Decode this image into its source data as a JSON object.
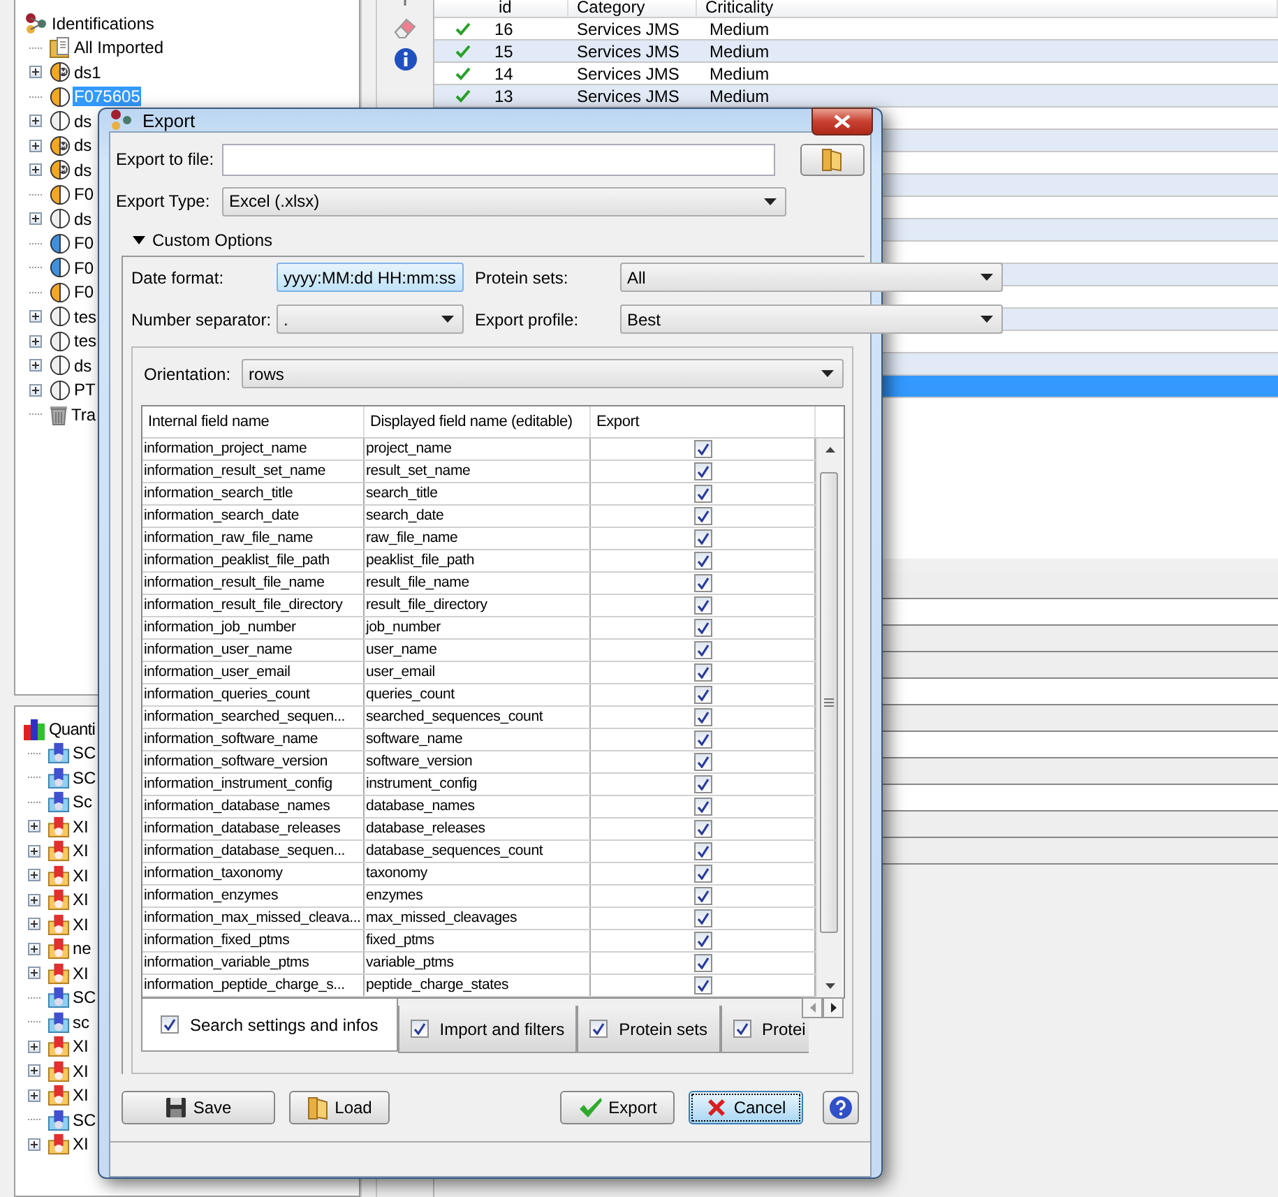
{
  "identifications_tree": {
    "title": "Identifications",
    "items": [
      {
        "label": "All Imported",
        "kind": "folder",
        "collapsed": false
      },
      {
        "label": "ds1",
        "kind": "merged",
        "color": "#f5a623",
        "collapsed": true
      },
      {
        "label": "F075605",
        "kind": "search",
        "color": "#f5a623",
        "collapsed": false,
        "selected": true
      },
      {
        "label": "ds",
        "kind": "search",
        "color": "#eeeeee",
        "collapsed": true
      },
      {
        "label": "ds",
        "kind": "merged",
        "color": "#f5a623",
        "collapsed": true
      },
      {
        "label": "ds",
        "kind": "merged",
        "color": "#f5a623",
        "collapsed": true
      },
      {
        "label": "F0",
        "kind": "search",
        "color": "#f5a623",
        "collapsed": false
      },
      {
        "label": "ds",
        "kind": "search",
        "color": "#eeeeee",
        "collapsed": true
      },
      {
        "label": "F0",
        "kind": "search",
        "color": "#3d8fe0",
        "collapsed": false
      },
      {
        "label": "F0",
        "kind": "search",
        "color": "#3d8fe0",
        "collapsed": false
      },
      {
        "label": "F0",
        "kind": "search",
        "color": "#f5a623",
        "collapsed": false
      },
      {
        "label": "tes",
        "kind": "search",
        "color": "#eeeeee",
        "collapsed": true
      },
      {
        "label": "tes",
        "kind": "search",
        "color": "#eeeeee",
        "collapsed": true
      },
      {
        "label": "ds",
        "kind": "search",
        "color": "#eeeeee",
        "collapsed": true
      },
      {
        "label": "PT",
        "kind": "search",
        "color": "#eeeeee",
        "collapsed": true
      },
      {
        "label": "Tra",
        "kind": "trash",
        "collapsed": false
      }
    ]
  },
  "quantitation_tree": {
    "title": "Quanti",
    "items": [
      {
        "label": "SC",
        "kind": "sc",
        "collapsed": false
      },
      {
        "label": "SC",
        "kind": "sc",
        "collapsed": false
      },
      {
        "label": "Sc",
        "kind": "sc",
        "collapsed": false
      },
      {
        "label": "XI",
        "kind": "xic",
        "collapsed": true
      },
      {
        "label": "XI",
        "kind": "xic",
        "collapsed": true
      },
      {
        "label": "XI",
        "kind": "xic",
        "collapsed": true
      },
      {
        "label": "XI",
        "kind": "xic",
        "collapsed": true
      },
      {
        "label": "XI",
        "kind": "xic",
        "collapsed": true
      },
      {
        "label": "ne",
        "kind": "xic",
        "collapsed": true
      },
      {
        "label": "XI",
        "kind": "xic",
        "collapsed": true
      },
      {
        "label": "SC",
        "kind": "sc",
        "collapsed": false
      },
      {
        "label": "sc",
        "kind": "sc",
        "collapsed": false
      },
      {
        "label": "XI",
        "kind": "xic",
        "collapsed": true
      },
      {
        "label": "XI",
        "kind": "xic",
        "collapsed": true
      },
      {
        "label": "XI",
        "kind": "xic",
        "collapsed": true
      },
      {
        "label": "SC",
        "kind": "sc",
        "collapsed": false
      },
      {
        "label": "XI",
        "kind": "xic",
        "collapsed": true
      }
    ]
  },
  "results_table": {
    "columns": [
      "id",
      "Category",
      "Criticality"
    ],
    "rows": [
      {
        "selected": false,
        "cells": [
          "16",
          "Services JMS",
          "Medium"
        ]
      },
      {
        "selected": false,
        "cells": [
          "15",
          "Services JMS",
          "Medium"
        ]
      },
      {
        "selected": false,
        "cells": [
          "14",
          "Services JMS",
          "Medium"
        ]
      },
      {
        "selected": false,
        "cells": [
          "13",
          "Services JMS",
          "Medium"
        ]
      }
    ],
    "empty_rows": [
      {
        "selected": false
      },
      {
        "selected": false
      },
      {
        "selected": false
      },
      {
        "selected": false
      },
      {
        "selected": false
      },
      {
        "selected": false
      },
      {
        "selected": false
      },
      {
        "selected": false
      },
      {
        "selected": false
      },
      {
        "selected": false
      },
      {
        "selected": false
      },
      {
        "selected": false
      },
      {
        "selected": true
      }
    ]
  },
  "dialog": {
    "title": "Export",
    "export_to_file": {
      "label": "Export to file:"
    },
    "export_type": {
      "label": "Export Type:",
      "value": "Excel (.xlsx)"
    },
    "custom_options": {
      "label": "Custom Options",
      "expanded": true
    },
    "options": [
      {
        "label": "Date format:",
        "value": "yyyy:MM:dd HH:mm:ss",
        "focused": true
      },
      {
        "label": "Protein sets:",
        "value": "All",
        "focused": false
      },
      {
        "label": "Number separator:",
        "value": ".",
        "focused": false
      },
      {
        "label": "Export profile:",
        "value": "Best",
        "focused": false
      }
    ],
    "orientation": {
      "label": "Orientation:",
      "value": "rows"
    },
    "fields_table": {
      "columns": [
        "Internal field name",
        "Displayed field name (editable)",
        "Export"
      ],
      "rows": [
        {
          "internal": "information_project_name",
          "displayed": "project_name",
          "export": true
        },
        {
          "internal": "information_result_set_name",
          "displayed": "result_set_name",
          "export": true
        },
        {
          "internal": "information_search_title",
          "displayed": "search_title",
          "export": true
        },
        {
          "internal": "information_search_date",
          "displayed": "search_date",
          "export": true
        },
        {
          "internal": "information_raw_file_name",
          "displayed": "raw_file_name",
          "export": true
        },
        {
          "internal": "information_peaklist_file_path",
          "displayed": "peaklist_file_path",
          "export": true
        },
        {
          "internal": "information_result_file_name",
          "displayed": "result_file_name",
          "export": true
        },
        {
          "internal": "information_result_file_directory",
          "displayed": "result_file_directory",
          "export": true
        },
        {
          "internal": "information_job_number",
          "displayed": "job_number",
          "export": true
        },
        {
          "internal": "information_user_name",
          "displayed": "user_name",
          "export": true
        },
        {
          "internal": "information_user_email",
          "displayed": "user_email",
          "export": true
        },
        {
          "internal": "information_queries_count",
          "displayed": "queries_count",
          "export": true
        },
        {
          "internal": "information_searched_sequen...",
          "displayed": "searched_sequences_count",
          "export": true
        },
        {
          "internal": "information_software_name",
          "displayed": "software_name",
          "export": true
        },
        {
          "internal": "information_software_version",
          "displayed": "software_version",
          "export": true
        },
        {
          "internal": "information_instrument_config",
          "displayed": "instrument_config",
          "export": true
        },
        {
          "internal": "information_database_names",
          "displayed": "database_names",
          "export": true
        },
        {
          "internal": "information_database_releases",
          "displayed": "database_releases",
          "export": true
        },
        {
          "internal": "information_database_sequen...",
          "displayed": "database_sequences_count",
          "export": true
        },
        {
          "internal": "information_taxonomy",
          "displayed": "taxonomy",
          "export": true
        },
        {
          "internal": "information_enzymes",
          "displayed": "enzymes",
          "export": true
        },
        {
          "internal": "information_max_missed_cleava...",
          "displayed": "max_missed_cleavages",
          "export": true
        },
        {
          "internal": "information_fixed_ptms",
          "displayed": "fixed_ptms",
          "export": true
        },
        {
          "internal": "information_variable_ptms",
          "displayed": "variable_ptms",
          "export": true
        },
        {
          "internal": "information_peptide_charge_s...",
          "displayed": "peptide_charge_states",
          "export": true
        }
      ]
    },
    "tabs": [
      {
        "label": "Search settings and infos",
        "checked": true,
        "selected": true
      },
      {
        "label": "Import and filters",
        "checked": true,
        "selected": false
      },
      {
        "label": "Protein sets",
        "checked": true,
        "selected": false
      },
      {
        "label": "Protei",
        "checked": true,
        "selected": false
      }
    ],
    "buttons": [
      {
        "label": "Save",
        "kind": "save",
        "default": false
      },
      {
        "label": "Load",
        "kind": "load",
        "default": false
      },
      {
        "label": "Export",
        "kind": "export",
        "default": false
      },
      {
        "label": "Cancel",
        "kind": "cancel",
        "default": true
      }
    ]
  }
}
